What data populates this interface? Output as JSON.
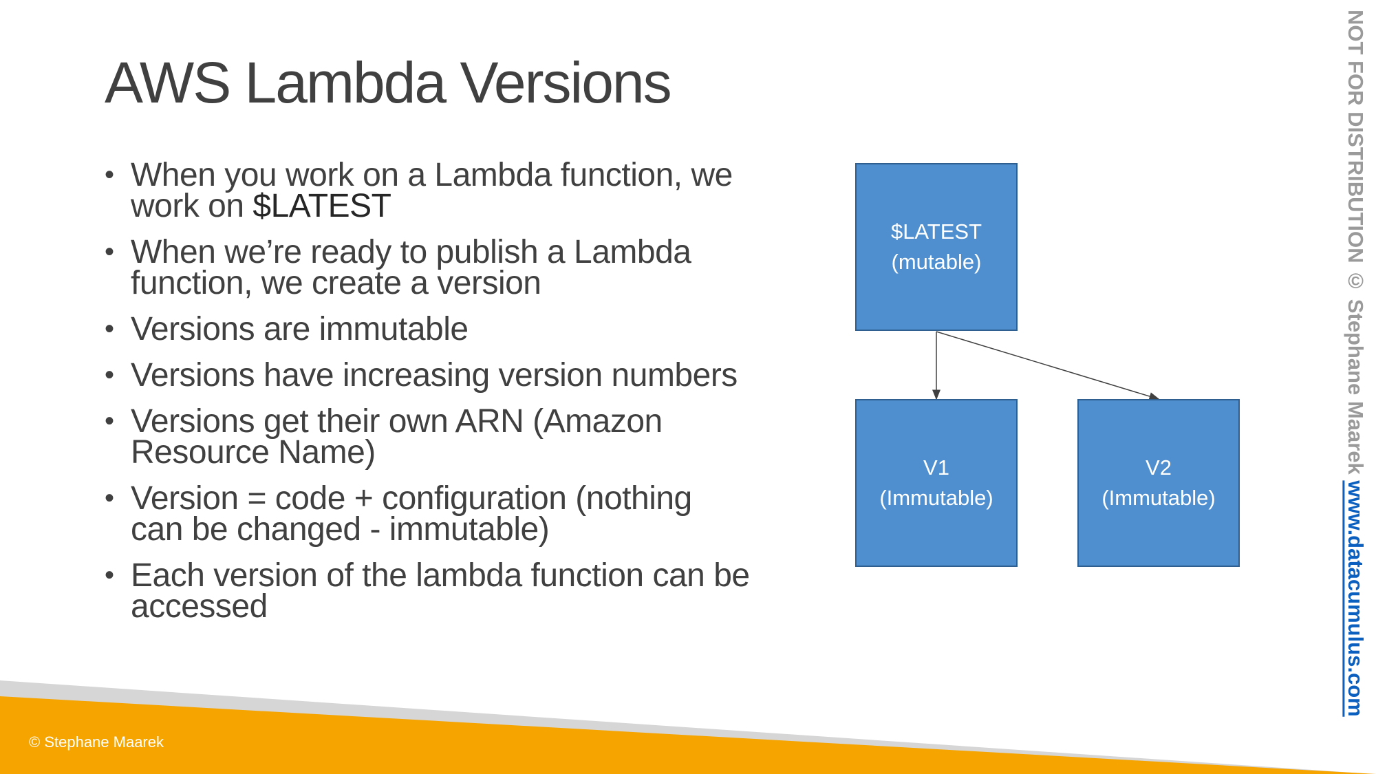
{
  "title": "AWS Lambda Versions",
  "bullets": [
    {
      "text": "When you work on a Lambda function, we work on ",
      "highlight": "$LATEST"
    },
    {
      "text": "When we’re ready to publish a Lambda function, we create a version"
    },
    {
      "text": "Versions are immutable"
    },
    {
      "text": "Versions have increasing version numbers"
    },
    {
      "text": "Versions get their own ARN (Amazon Resource Name)"
    },
    {
      "text": "Version = code + configuration (nothing can be changed - immutable)"
    },
    {
      "text": "Each version of the lambda function can be accessed"
    }
  ],
  "diagram": {
    "latest": {
      "name": "$LATEST",
      "note": "(mutable)"
    },
    "v1": {
      "name": "V1",
      "note": "(Immutable)"
    },
    "v2": {
      "name": "V2",
      "note": "(Immutable)"
    }
  },
  "footer": {
    "copyright": "© Stephane Maarek"
  },
  "watermark": {
    "text": "NOT FOR DISTRIBUTION © Stephane Maarek ",
    "link": "www.datacumulus.com"
  },
  "colors": {
    "box": "#4f8fcf",
    "orange": "#f6a500",
    "gray": "#d6d6d6",
    "link": "#0a5fbf"
  }
}
